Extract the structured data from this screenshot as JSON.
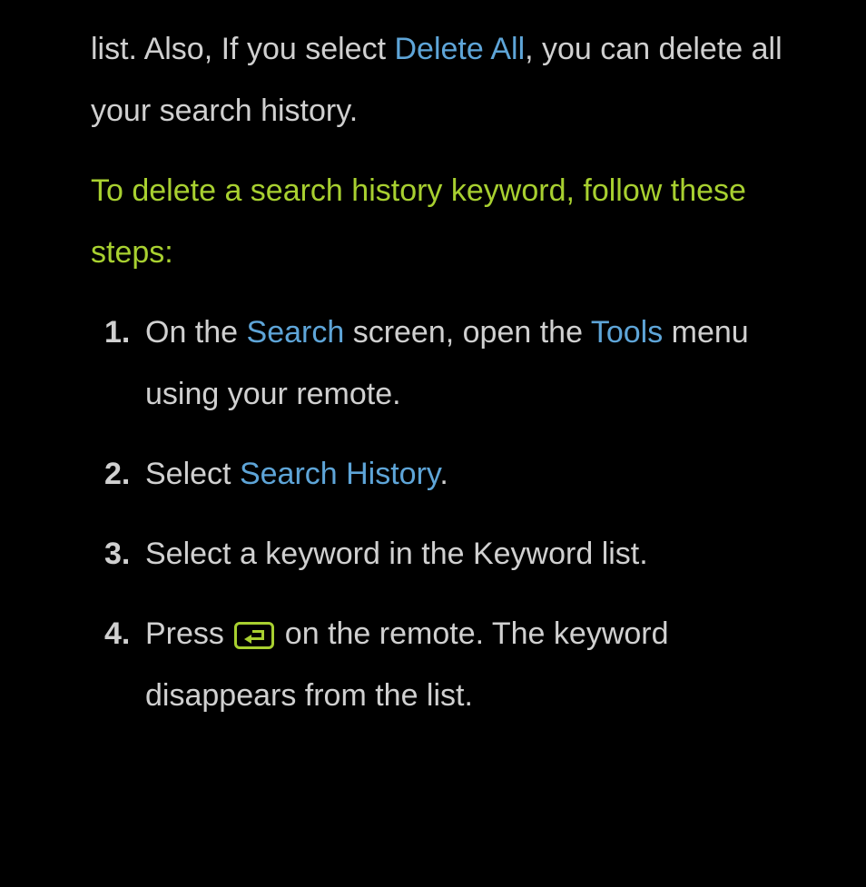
{
  "intro": {
    "part1": "list. Also, If you select ",
    "deleteAll": "Delete All",
    "part2": ", you can delete all your search history."
  },
  "heading": "To delete a search history keyword, follow these steps:",
  "steps": [
    {
      "part1": "On the ",
      "blue1": "Search",
      "part2": " screen, open the ",
      "blue2": "Tools",
      "part3": " menu using your remote."
    },
    {
      "part1": "Select ",
      "blue1": "Search History",
      "part2": "."
    },
    {
      "part1": "Select a keyword in the Keyword list."
    },
    {
      "part1": "Press ",
      "part2": " on the remote. The keyword disappears from the list."
    }
  ]
}
